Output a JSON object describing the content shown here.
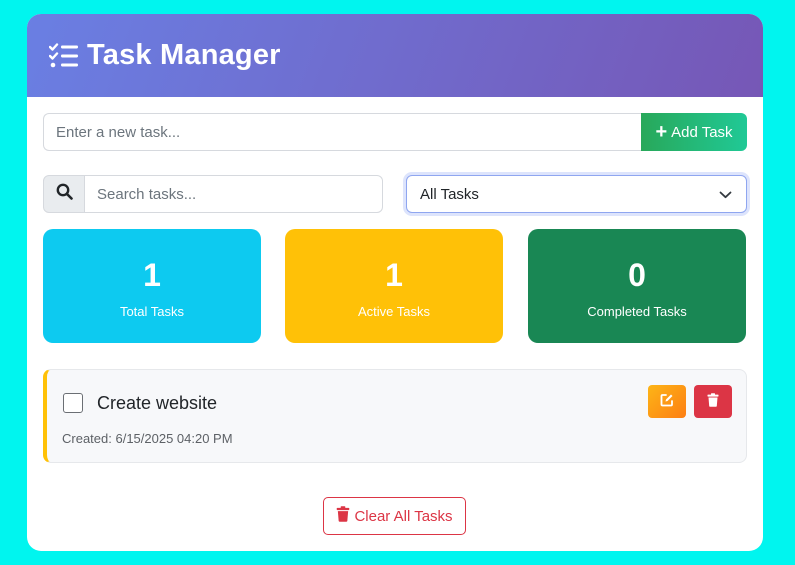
{
  "header": {
    "title": "Task Manager",
    "icon": "tasks-icon"
  },
  "add_task": {
    "placeholder": "Enter a new task...",
    "button_label": "Add Task",
    "button_icon": "plus-icon"
  },
  "search": {
    "placeholder": "Search tasks...",
    "icon": "search-icon"
  },
  "filter": {
    "selected": "All Tasks",
    "icon": "chevron-down-icon"
  },
  "stats": {
    "total": {
      "value": "1",
      "label": "Total Tasks",
      "color": "#0dcaf0"
    },
    "active": {
      "value": "1",
      "label": "Active Tasks",
      "color": "#ffc107"
    },
    "completed": {
      "value": "0",
      "label": "Completed Tasks",
      "color": "#198754"
    }
  },
  "tasks": [
    {
      "title": "Create website",
      "created": "Created: 6/15/2025 04:20 PM",
      "completed": false,
      "edit_icon": "edit-icon",
      "delete_icon": "trash-icon"
    }
  ],
  "footer": {
    "clear_label": "Clear All Tasks",
    "clear_icon": "trash-icon"
  },
  "colors": {
    "background": "#00f5ef",
    "header_gradient_start": "#6a7fe3",
    "header_gradient_end": "#7657b6",
    "danger": "#dc3545"
  }
}
